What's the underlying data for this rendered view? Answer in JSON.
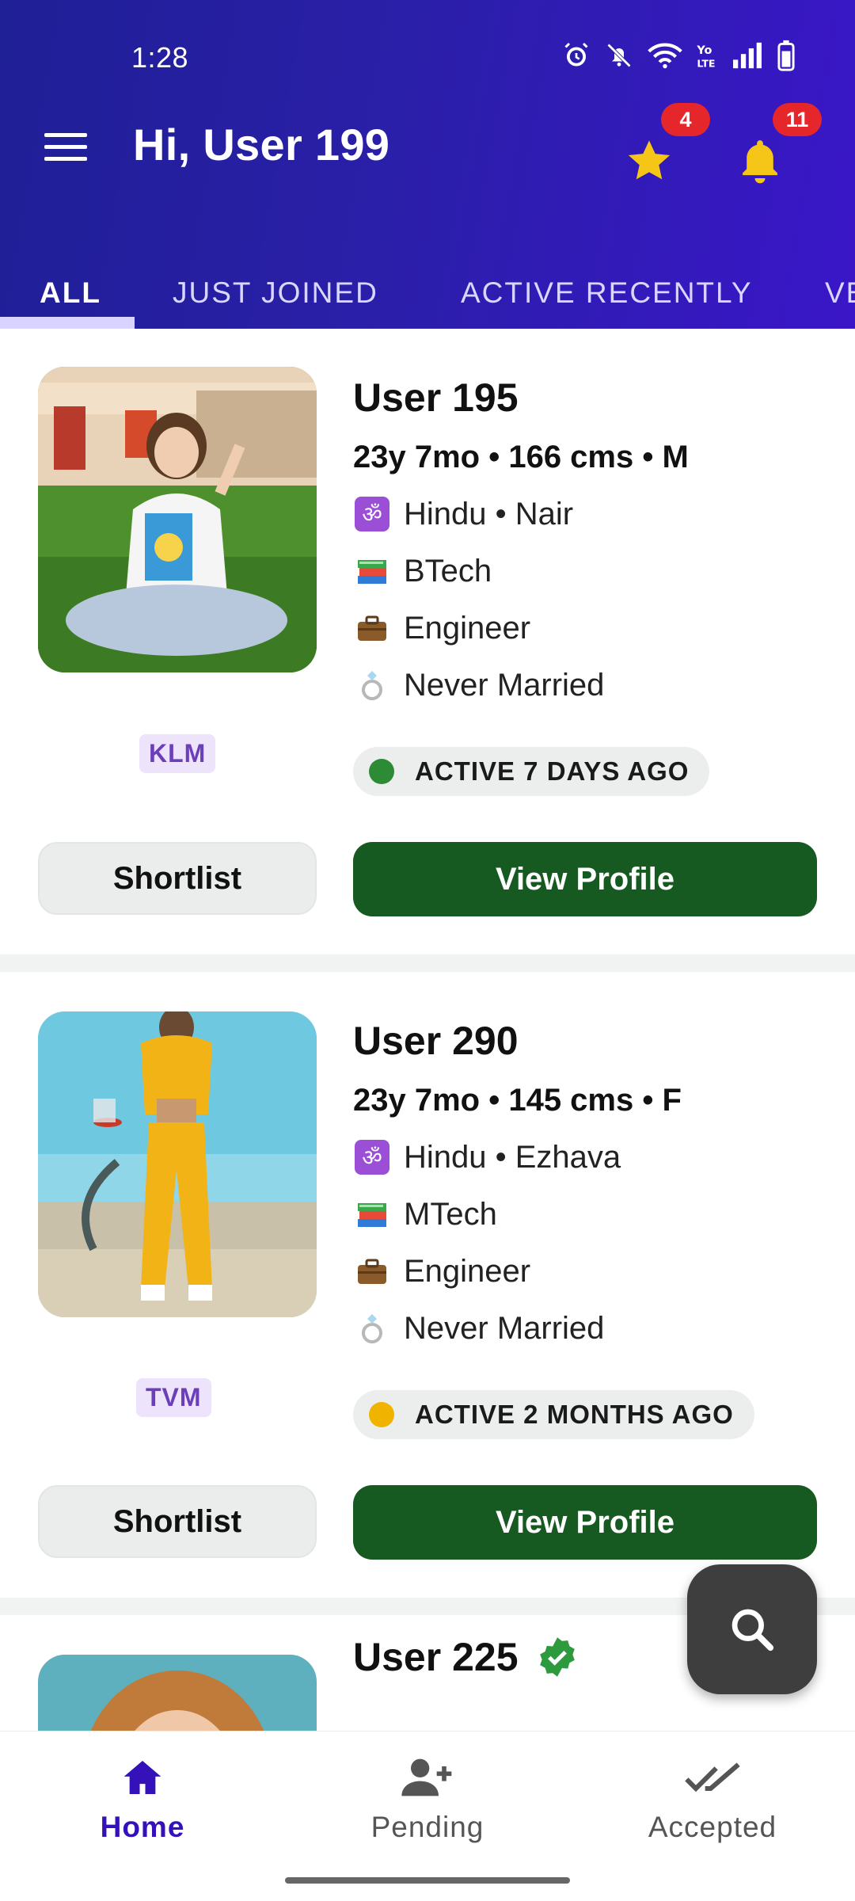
{
  "status_bar": {
    "time": "1:28"
  },
  "header": {
    "greeting": "Hi, User 199",
    "star_badge": "4",
    "bell_badge": "11"
  },
  "tabs": [
    {
      "label": "ALL"
    },
    {
      "label": "JUST JOINED"
    },
    {
      "label": "ACTIVE RECENTLY"
    },
    {
      "label": "VE"
    }
  ],
  "profiles": [
    {
      "name": "User 195",
      "stats": "23y 7mo • 166 cms • M",
      "religion": "Hindu • Nair",
      "education": "BTech",
      "occupation": "Engineer",
      "marital": "Never Married",
      "location": "KLM",
      "activity": "ACTIVE 7 DAYS AGO",
      "activity_color": "#2e8b35",
      "shortlist_label": "Shortlist",
      "view_label": "View Profile"
    },
    {
      "name": "User 290",
      "stats": "23y 7mo • 145 cms • F",
      "religion": "Hindu • Ezhava",
      "education": "MTech",
      "occupation": "Engineer",
      "marital": "Never Married",
      "location": "TVM",
      "activity": "ACTIVE 2 MONTHS AGO",
      "activity_color": "#f0b400",
      "shortlist_label": "Shortlist",
      "view_label": "View Profile"
    },
    {
      "name": "User 225",
      "verified": true
    }
  ],
  "bottom_nav": [
    {
      "label": "Home",
      "icon": "home-icon"
    },
    {
      "label": "Pending",
      "icon": "add-person-icon"
    },
    {
      "label": "Accepted",
      "icon": "double-check-icon"
    }
  ],
  "colors": {
    "header_start": "#1f1f96",
    "header_end": "#3a16c8",
    "primary_button": "#165a22",
    "active_nav": "#3411b8",
    "badge": "#e5262b"
  }
}
